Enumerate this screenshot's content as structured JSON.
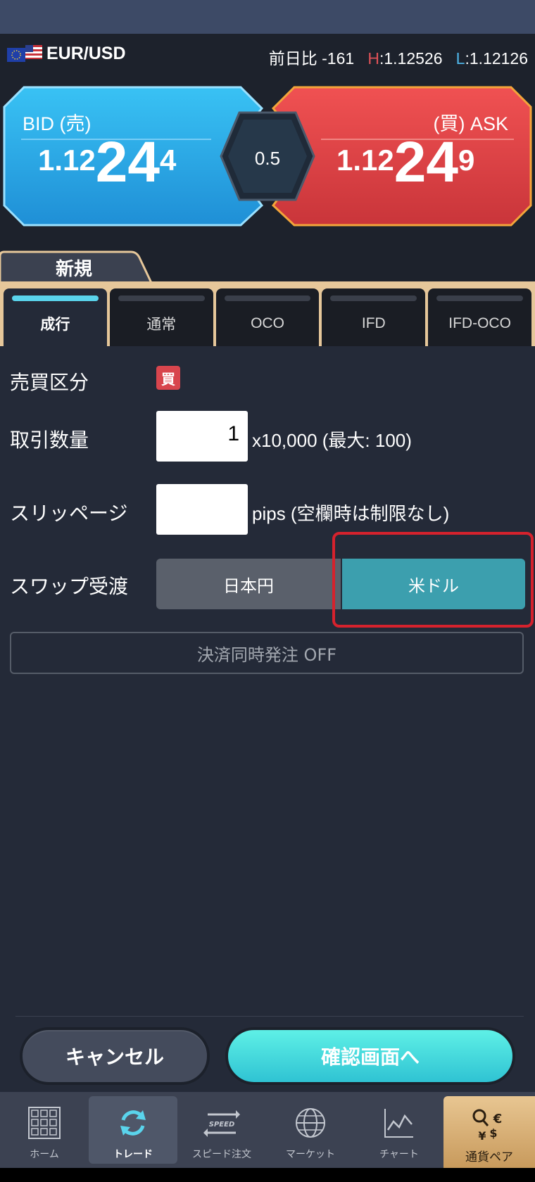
{
  "header": {
    "pair": "EUR/USD",
    "change_label": "前日比",
    "change_value": "-161",
    "high_prefix": "H",
    "high_value": ":1.12526",
    "low_prefix": "L",
    "low_value": ":1.12126"
  },
  "quote": {
    "bid_label": "BID (売)",
    "bid_small": "1.12",
    "bid_big": "24",
    "bid_pip": "4",
    "ask_label": "(買) ASK",
    "ask_small": "1.12",
    "ask_big": "24",
    "ask_pip": "9",
    "spread": "0.5"
  },
  "order_tab": "新規",
  "order_types": [
    {
      "label": "成行",
      "active": true
    },
    {
      "label": "通常",
      "active": false
    },
    {
      "label": "OCO",
      "active": false
    },
    {
      "label": "IFD",
      "active": false
    },
    {
      "label": "IFD-OCO",
      "active": false
    }
  ],
  "form": {
    "side_label": "売買区分",
    "side_badge": "買",
    "qty_label": "取引数量",
    "qty_value": "1",
    "qty_suffix": "x10,000 (最大: 100)",
    "slippage_label": "スリッページ",
    "slippage_value": "",
    "slippage_suffix": "pips (空欄時は制限なし)",
    "swap_label": "スワップ受渡",
    "swap_options": [
      "日本円",
      "米ドル"
    ],
    "swap_selected": "米ドル",
    "settle_order": "決済同時発注 OFF"
  },
  "buttons": {
    "cancel": "キャンセル",
    "confirm": "確認画面へ"
  },
  "nav": [
    {
      "label": "ホーム",
      "icon": "home-grid-icon"
    },
    {
      "label": "トレード",
      "icon": "trade-cycle-icon",
      "active": true
    },
    {
      "label": "スピード注文",
      "icon": "speed-arrows-icon"
    },
    {
      "label": "マーケット",
      "icon": "globe-icon"
    },
    {
      "label": "チャート",
      "icon": "chart-icon"
    },
    {
      "label": "通貨ペア",
      "icon": "currency-search-icon"
    }
  ],
  "colors": {
    "bid": "#2ea8e4",
    "ask": "#e04a4c",
    "accent": "#3c9fae",
    "gold": "#e6c79a"
  }
}
